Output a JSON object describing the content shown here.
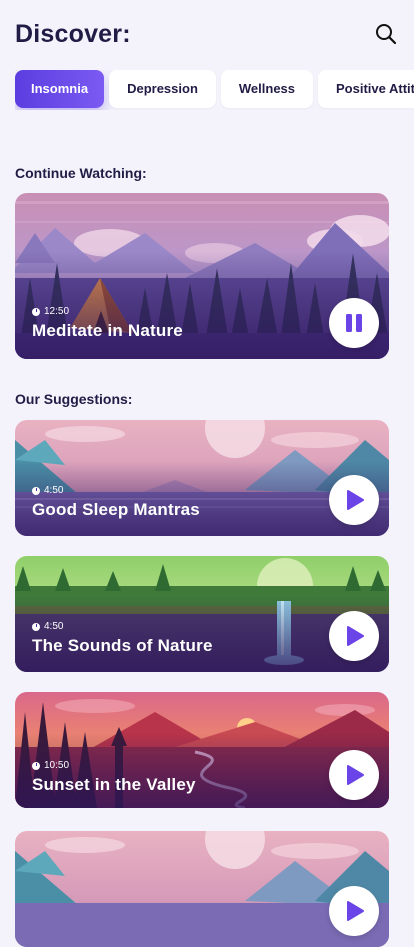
{
  "header": {
    "title": "Discover:"
  },
  "categories": [
    {
      "label": "Insomnia",
      "active": true
    },
    {
      "label": "Depression",
      "active": false
    },
    {
      "label": "Wellness",
      "active": false
    },
    {
      "label": "Positive Attitude",
      "active": false
    }
  ],
  "continue_section": {
    "title": "Continue Watching:"
  },
  "continue_item": {
    "duration": "12:50",
    "title": "Meditate in Nature",
    "state_icon": "pause-icon"
  },
  "suggestions_section": {
    "title": "Our Suggestions:"
  },
  "suggestions": [
    {
      "duration": "4:50",
      "title": "Good Sleep Mantras"
    },
    {
      "duration": "4:50",
      "title": "The Sounds of Nature"
    },
    {
      "duration": "10:50",
      "title": "Sunset in the Valley"
    }
  ],
  "colors": {
    "accent": "#5b3ee0",
    "background": "#f4f3fb",
    "text": "#211c45"
  }
}
